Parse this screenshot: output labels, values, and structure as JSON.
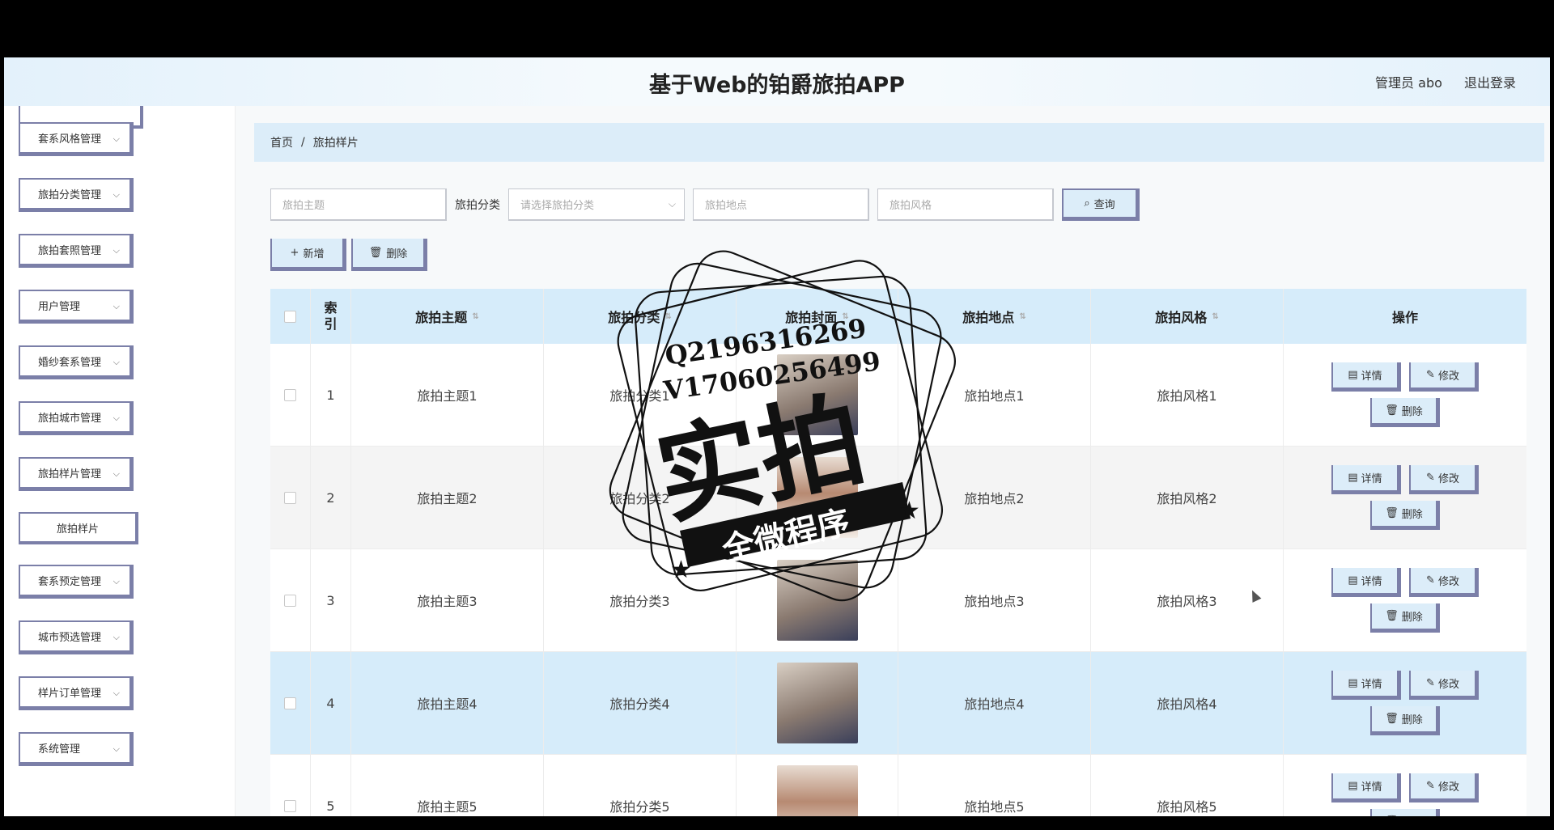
{
  "header": {
    "title": "基于Web的铂爵旅拍APP",
    "user": "管理员 abo",
    "logout": "退出登录"
  },
  "sidebar": {
    "items": [
      {
        "label": "套系风格管理"
      },
      {
        "label": "旅拍分类管理"
      },
      {
        "label": "旅拍套照管理"
      },
      {
        "label": "用户管理"
      },
      {
        "label": "婚纱套系管理"
      },
      {
        "label": "旅拍城市管理"
      },
      {
        "label": "旅拍样片管理"
      },
      {
        "label": "套系预定管理"
      },
      {
        "label": "城市预选管理"
      },
      {
        "label": "样片订单管理"
      },
      {
        "label": "系统管理"
      }
    ],
    "sub_item": "旅拍样片"
  },
  "breadcrumb": {
    "home": "首页",
    "sep": "/",
    "current": "旅拍样片"
  },
  "search": {
    "theme_placeholder": "旅拍主题",
    "category_label": "旅拍分类",
    "category_placeholder": "请选择旅拍分类",
    "location_placeholder": "旅拍地点",
    "style_placeholder": "旅拍风格",
    "query_label": "查询"
  },
  "actions": {
    "add": "新增",
    "delete": "删除"
  },
  "table": {
    "headers": {
      "index": "索引",
      "theme": "旅拍主题",
      "category": "旅拍分类",
      "cover": "旅拍封面",
      "location": "旅拍地点",
      "style": "旅拍风格",
      "ops": "操作"
    },
    "rows": [
      {
        "index": "1",
        "theme": "旅拍主题1",
        "category": "旅拍分类1",
        "location": "旅拍地点1",
        "style": "旅拍风格1"
      },
      {
        "index": "2",
        "theme": "旅拍主题2",
        "category": "旅拍分类2",
        "location": "旅拍地点2",
        "style": "旅拍风格2"
      },
      {
        "index": "3",
        "theme": "旅拍主题3",
        "category": "旅拍分类3",
        "location": "旅拍地点3",
        "style": "旅拍风格3"
      },
      {
        "index": "4",
        "theme": "旅拍主题4",
        "category": "旅拍分类4",
        "location": "旅拍地点4",
        "style": "旅拍风格4"
      },
      {
        "index": "5",
        "theme": "旅拍主题5",
        "category": "旅拍分类5",
        "location": "旅拍地点5",
        "style": "旅拍风格5"
      }
    ],
    "op_labels": {
      "detail": "详情",
      "edit": "修改",
      "delete": "删除"
    }
  },
  "watermark": {
    "line1": "Q2196316269",
    "line2": "V17060256499",
    "big": "实拍",
    "banner": "全微程序"
  },
  "icons": {
    "chevron": "chevron-down-icon",
    "search": "search-icon",
    "plus": "plus-icon",
    "trash": "trash-icon",
    "doc": "document-icon",
    "pen": "edit-icon"
  }
}
